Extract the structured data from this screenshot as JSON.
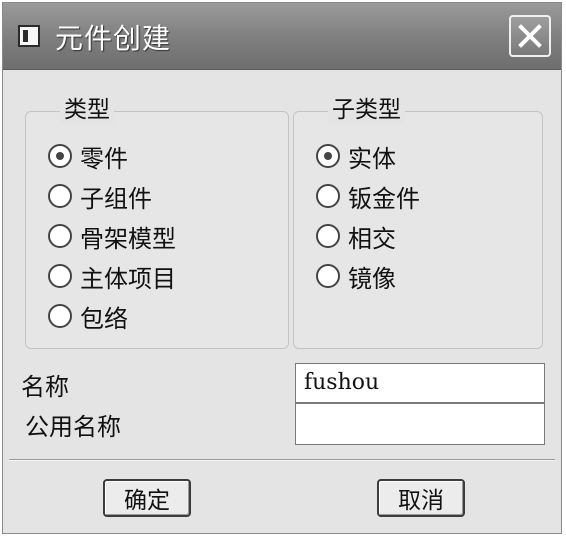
{
  "dialog": {
    "title": "元件创建",
    "close_glyph": "✕"
  },
  "type_group": {
    "legend": "类型",
    "options": [
      "零件",
      "子组件",
      "骨架模型",
      "主体项目",
      "包络"
    ],
    "selected": "零件"
  },
  "subtype_group": {
    "legend": "子类型",
    "options": [
      "实体",
      "钣金件",
      "相交",
      "镜像"
    ],
    "selected": "实体"
  },
  "fields": {
    "name_label": "名称",
    "name_value": "fushou",
    "common_name_label": "公用名称",
    "common_name_value": ""
  },
  "buttons": {
    "ok_label": "确定",
    "cancel_label": "取消"
  },
  "icons": {
    "title_icon": "window-icon",
    "close_icon": "close-icon",
    "radio_selected": "radio-selected-icon",
    "radio_unselected": "radio-unselected-icon"
  }
}
